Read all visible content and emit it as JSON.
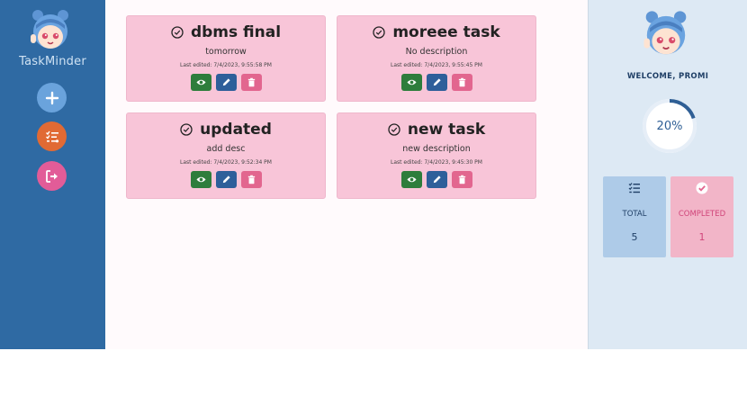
{
  "sidebar": {
    "brand": "TaskMinder",
    "buttons": [
      {
        "name": "add-task",
        "icon": "plus-icon",
        "color": "#6aa3dc"
      },
      {
        "name": "task-list",
        "icon": "checklist-icon",
        "color": "#e16a34"
      },
      {
        "name": "logout",
        "icon": "logout-icon",
        "color": "#e25c98"
      }
    ]
  },
  "tasks": [
    {
      "title": "dbms final",
      "description": "tomorrow",
      "edited": "Last edited: 7/4/2023, 9:55:58 PM"
    },
    {
      "title": "moreee task",
      "description": "No description",
      "edited": "Last edited: 7/4/2023, 9:55:45 PM"
    },
    {
      "title": "updated",
      "description": "add desc",
      "edited": "Last edited: 7/4/2023, 9:52:34 PM"
    },
    {
      "title": "new task",
      "description": "new description",
      "edited": "Last edited: 7/4/2023, 9:45:30 PM"
    }
  ],
  "panel": {
    "welcome": "WELCOME, PROMI",
    "progress_label": "20%",
    "progress_fraction": 0.2,
    "stats": {
      "total_label": "TOTAL",
      "total_value": "5",
      "completed_label": "COMPLETED",
      "completed_value": "1"
    }
  },
  "colors": {
    "sidebar": "#2f6aa3",
    "card": "#f8c5d8",
    "view": "#2e7d3c",
    "edit": "#2e5f9a",
    "delete": "#e2668f",
    "progress": "#2f5f95"
  }
}
